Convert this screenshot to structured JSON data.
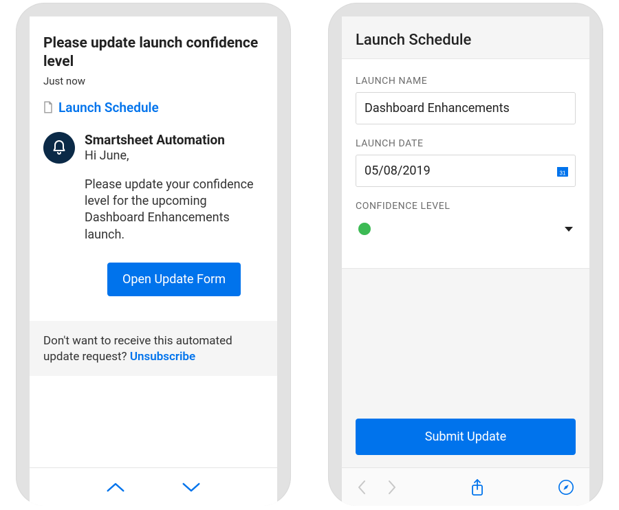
{
  "colors": {
    "primary": "#0073ec",
    "bell_bg": "#0b2a47",
    "status_green": "#3cba54"
  },
  "notification": {
    "title": "Please update launch confidence level",
    "time": "Just now",
    "link_label": "Launch Schedule",
    "sender": "Smartsheet Automation",
    "greeting": "Hi June,",
    "body": "Please update your confidence level for the upcoming Dashboard Enhancements launch.",
    "cta_label": "Open Update Form",
    "unsubscribe_lead": "Don't want to receive this automated update request? ",
    "unsubscribe_link": "Unsubscribe"
  },
  "form": {
    "header": "Launch Schedule",
    "launch_name_label": "LAUNCH NAME",
    "launch_name_value": "Dashboard Enhancements",
    "launch_date_label": "LAUNCH DATE",
    "launch_date_value": "05/08/2019",
    "confidence_label": "CONFIDENCE LEVEL",
    "submit_label": "Submit Update"
  }
}
